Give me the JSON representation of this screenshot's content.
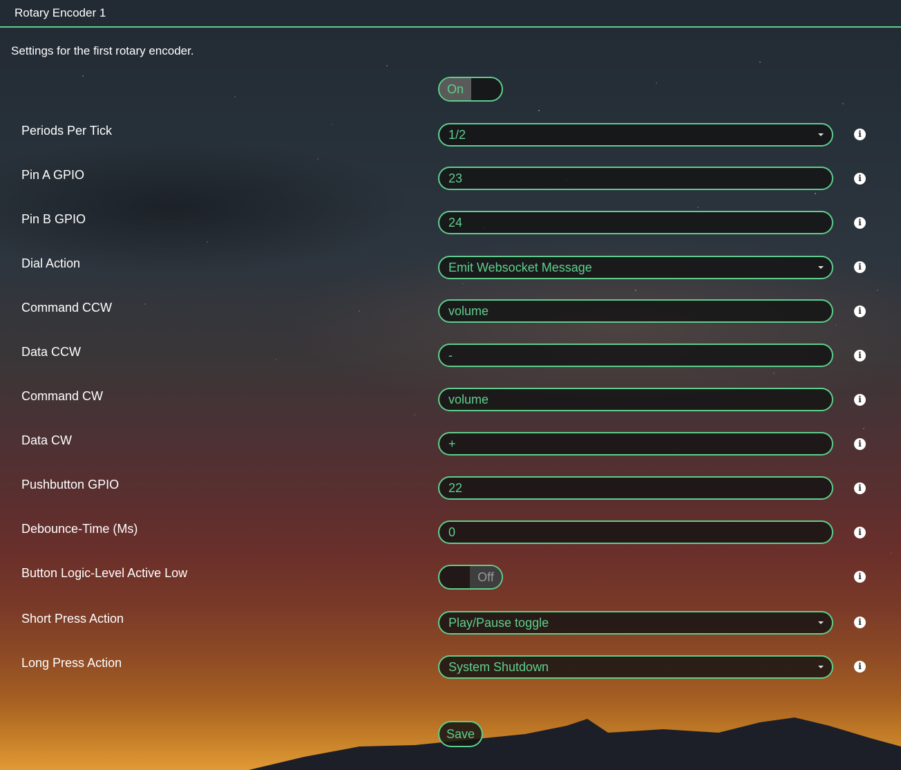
{
  "panel": {
    "title": "Rotary Encoder 1",
    "description": "Settings for the first rotary encoder."
  },
  "enable_toggle": {
    "on_label": "On",
    "state": "on"
  },
  "fields": {
    "periods_per_tick": {
      "label": "Periods Per Tick",
      "value": "1/2"
    },
    "pin_a_gpio": {
      "label": "Pin A GPIO",
      "value": "23"
    },
    "pin_b_gpio": {
      "label": "Pin B GPIO",
      "value": "24"
    },
    "dial_action": {
      "label": "Dial Action",
      "value": "Emit Websocket Message"
    },
    "command_ccw": {
      "label": "Command CCW",
      "value": "volume"
    },
    "data_ccw": {
      "label": "Data CCW",
      "value": "-"
    },
    "command_cw": {
      "label": "Command CW",
      "value": "volume"
    },
    "data_cw": {
      "label": "Data CW",
      "value": "+"
    },
    "pushbutton_gpio": {
      "label": "Pushbutton GPIO",
      "value": "22"
    },
    "debounce_time": {
      "label": "Debounce-Time (Ms)",
      "value": "0"
    },
    "button_logic_level": {
      "label": "Button Logic-Level Active Low",
      "off_label": "Off",
      "state": "off"
    },
    "short_press_action": {
      "label": "Short Press Action",
      "value": "Play/Pause toggle"
    },
    "long_press_action": {
      "label": "Long Press Action",
      "value": "System Shutdown"
    }
  },
  "save_label": "Save",
  "colors": {
    "accent": "#5fcf8d",
    "field_bg": "#141414",
    "text": "#ffffff"
  },
  "icons": {
    "info": "info-icon",
    "caret": "chevron-down-icon"
  }
}
